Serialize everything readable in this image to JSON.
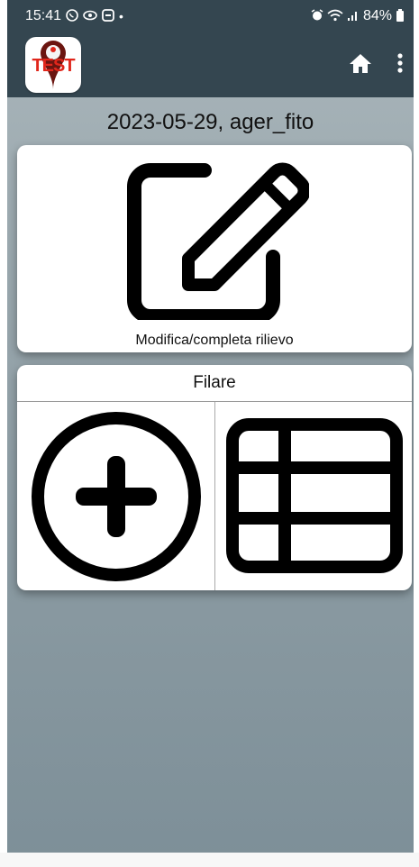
{
  "status_bar": {
    "time": "15:41",
    "battery": "84%",
    "icons_left": [
      "whatsapp-icon",
      "eye-icon",
      "message-icon",
      "dot"
    ],
    "icons_right": [
      "alarm-icon",
      "wifi-icon",
      "signal-icon",
      "battery-icon"
    ]
  },
  "app_bar": {
    "logo_text": "TEST",
    "actions": [
      "home-icon",
      "more-vert-icon"
    ],
    "colors": {
      "bar": "#344650",
      "logo_red": "#e0261b"
    }
  },
  "main": {
    "title": "2023-05-29, ager_fito",
    "edit_card": {
      "label": "Modifica/completa rilievo",
      "icon": "edit-icon"
    },
    "filare_card": {
      "header": "Filare",
      "buttons": [
        {
          "icon": "add-circle-icon"
        },
        {
          "icon": "table-icon"
        }
      ]
    }
  }
}
